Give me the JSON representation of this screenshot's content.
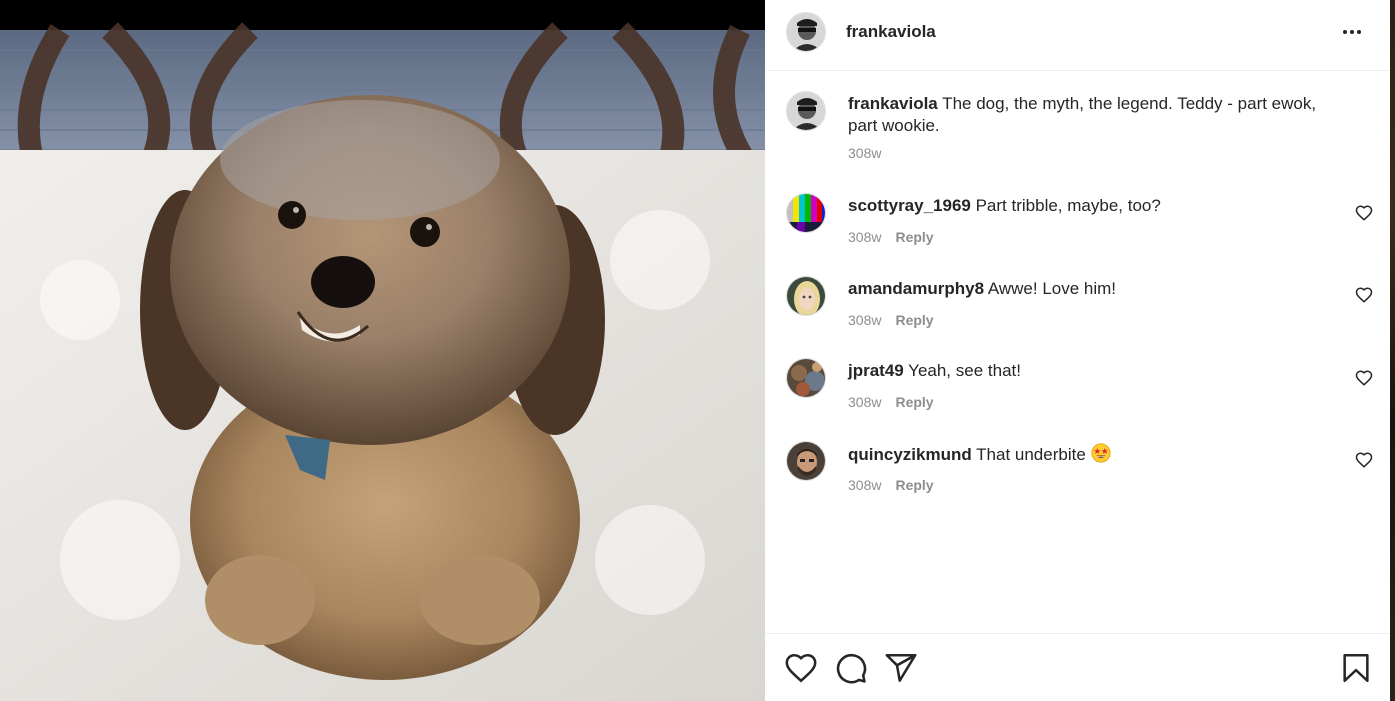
{
  "post": {
    "username": "frankaviola",
    "caption": {
      "username": "frankaviola",
      "text": " The dog, the myth, the legend. Teddy - part ewok, part wookie.",
      "age": "308w"
    },
    "photo_icon": "dog-photo"
  },
  "header": {
    "username": "frankaviola",
    "more_icon": "more-horizontal-icon"
  },
  "comments": [
    {
      "username": "scottyray_1969",
      "text": " Part tribble, maybe, too?",
      "age": "308w",
      "reply_label": "Reply"
    },
    {
      "username": "amandamurphy8",
      "text": " Awwe! Love him!",
      "age": "308w",
      "reply_label": "Reply"
    },
    {
      "username": "jprat49",
      "text": " Yeah, see that!",
      "age": "308w",
      "reply_label": "Reply"
    },
    {
      "username": "quincyzikmund",
      "text": " That underbite ",
      "age": "308w",
      "reply_label": "Reply",
      "emoji": "star-struck-emoji"
    }
  ],
  "actions": {
    "icons": [
      "heart-icon",
      "comment-icon",
      "share-icon",
      "bookmark-icon"
    ]
  },
  "colors": {
    "text": "#262626",
    "muted": "#8e8e8e",
    "divider": "#efefef",
    "background": "#ffffff"
  }
}
